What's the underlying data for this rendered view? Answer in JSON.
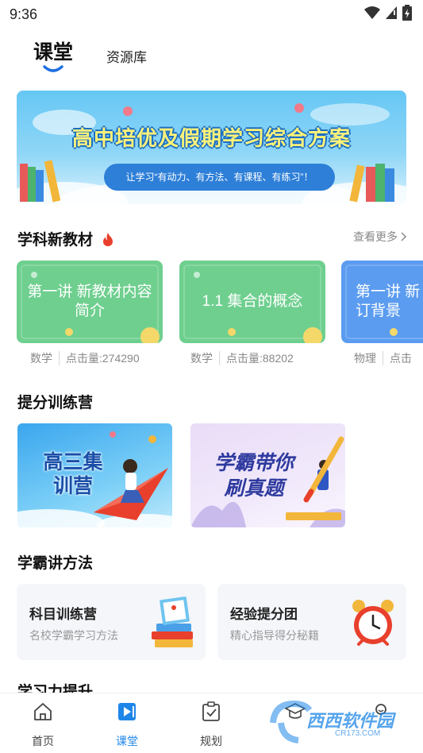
{
  "status_bar": {
    "time": "9:36"
  },
  "top_tabs": {
    "active": "课堂",
    "other": "资源库"
  },
  "banner": {
    "title": "高中培优及假期学习综合方案",
    "subtitle": "让学习“有动力、有方法、有课程、有练习”！"
  },
  "new_textbooks": {
    "title": "学科新教材",
    "see_more": "查看更多",
    "cards": [
      {
        "title": "第一讲 新教材内容简介",
        "subject": "数学",
        "clicks": "点击量:274290",
        "color": "#6fcf8f"
      },
      {
        "title": "1.1 集合的概念",
        "subject": "数学",
        "clicks": "点击量:88202",
        "color": "#6fcf8f"
      },
      {
        "title": "第一讲 新订背景",
        "subject": "物理",
        "clicks": "点击",
        "color": "#5b9cf0"
      }
    ]
  },
  "training_camp": {
    "title": "提分训练营",
    "cards": [
      {
        "label": "高三集训营"
      },
      {
        "label": "学霸带你刷真题"
      }
    ]
  },
  "methods": {
    "title": "学霸讲方法",
    "cards": [
      {
        "title": "科目训练营",
        "subtitle": "名校学霸学习方法"
      },
      {
        "title": "经验提分团",
        "subtitle": "精心指导得分秘籍"
      }
    ]
  },
  "next_section_peek": "学习力提升",
  "bottom_nav": {
    "items": [
      {
        "label": "首页",
        "icon": "home-icon"
      },
      {
        "label": "课堂",
        "icon": "video-play-icon"
      },
      {
        "label": "规划",
        "icon": "checklist-icon"
      },
      {
        "label": "",
        "icon": "graduation-cap-icon"
      },
      {
        "label": "",
        "icon": "profile-icon"
      }
    ],
    "active_color": "#1e86e8"
  },
  "watermark": {
    "text": "西西软件园",
    "subtext": "CR173.COM"
  }
}
